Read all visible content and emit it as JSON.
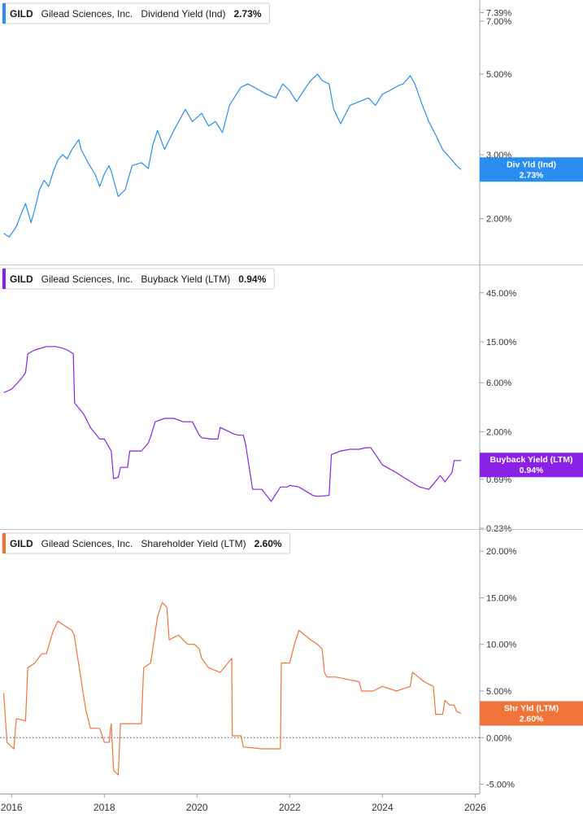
{
  "chart_data": [
    {
      "type": "line",
      "legend": {
        "ticker": "GILD",
        "company": "Gilead Sciences, Inc.",
        "metric": "Dividend Yield (Ind)",
        "value": "2.73%"
      },
      "color": "#2a8ef0",
      "scale": "log",
      "ylim": [
        1.7,
        7.6
      ],
      "yticks": [
        {
          "value": 7.39,
          "label": "7.39%"
        },
        {
          "value": 7.0,
          "label": "7.00%"
        },
        {
          "value": 5.0,
          "label": "5.00%"
        },
        {
          "value": 3.0,
          "label": "3.00%"
        },
        {
          "value": 2.0,
          "label": "2.00%"
        }
      ],
      "flag": {
        "label": "Div Yld (Ind)",
        "value": "2.73%",
        "at": 2.73
      },
      "x": [
        2015.83,
        2015.95,
        2016.1,
        2016.2,
        2016.3,
        2016.42,
        2016.5,
        2016.6,
        2016.7,
        2016.8,
        2016.9,
        2017.0,
        2017.1,
        2017.2,
        2017.3,
        2017.45,
        2017.5,
        2017.65,
        2017.8,
        2017.9,
        2018.0,
        2018.1,
        2018.15,
        2018.3,
        2018.45,
        2018.6,
        2018.8,
        2018.95,
        2019.05,
        2019.15,
        2019.3,
        2019.5,
        2019.75,
        2019.9,
        2020.1,
        2020.25,
        2020.4,
        2020.55,
        2020.7,
        2020.85,
        2020.95,
        2021.1,
        2021.3,
        2021.5,
        2021.7,
        2021.85,
        2022.0,
        2022.15,
        2022.3,
        2022.45,
        2022.6,
        2022.7,
        2022.85,
        2022.95,
        2023.1,
        2023.3,
        2023.5,
        2023.7,
        2023.85,
        2024.0,
        2024.15,
        2024.35,
        2024.45,
        2024.6,
        2024.7,
        2024.85,
        2025.0,
        2025.15,
        2025.3,
        2025.5,
        2025.6,
        2025.7
      ],
      "values": [
        1.82,
        1.78,
        1.9,
        2.05,
        2.2,
        1.95,
        2.12,
        2.4,
        2.55,
        2.45,
        2.7,
        2.9,
        3.0,
        2.92,
        3.1,
        3.3,
        3.1,
        2.85,
        2.65,
        2.45,
        2.65,
        2.8,
        2.7,
        2.3,
        2.4,
        2.8,
        2.85,
        2.75,
        3.2,
        3.5,
        3.1,
        3.5,
        4.0,
        3.7,
        3.9,
        3.6,
        3.7,
        3.45,
        4.1,
        4.4,
        4.6,
        4.7,
        4.55,
        4.4,
        4.3,
        4.7,
        4.5,
        4.2,
        4.5,
        4.8,
        5.0,
        4.8,
        4.7,
        4.0,
        3.65,
        4.1,
        4.2,
        4.3,
        4.1,
        4.4,
        4.5,
        4.65,
        4.7,
        4.95,
        4.7,
        4.15,
        3.7,
        3.4,
        3.1,
        2.9,
        2.8,
        2.73
      ]
    },
    {
      "type": "line",
      "legend": {
        "ticker": "GILD",
        "company": "Gilead Sciences, Inc.",
        "metric": "Buyback Yield (LTM)",
        "value": "0.94%"
      },
      "color": "#8a22e6",
      "scale": "log",
      "ylim": [
        0.23,
        60
      ],
      "yticks": [
        {
          "value": 45.0,
          "label": "45.00%"
        },
        {
          "value": 15.0,
          "label": "15.00%"
        },
        {
          "value": 6.0,
          "label": "6.00%"
        },
        {
          "value": 2.0,
          "label": "2.00%"
        },
        {
          "value": 0.69,
          "label": "0.69%"
        },
        {
          "value": 0.23,
          "label": "0.23%"
        }
      ],
      "flag": {
        "label": "Buyback Yield (LTM)",
        "value": "0.94%",
        "at": 0.95
      },
      "x": [
        2015.83,
        2016.0,
        2016.2,
        2016.3,
        2016.35,
        2016.5,
        2016.75,
        2016.95,
        2017.1,
        2017.2,
        2017.33,
        2017.36,
        2017.55,
        2017.7,
        2017.9,
        2018.0,
        2018.15,
        2018.2,
        2018.3,
        2018.35,
        2018.5,
        2018.55,
        2018.8,
        2018.95,
        2019.0,
        2019.1,
        2019.3,
        2019.5,
        2019.7,
        2019.9,
        2020.05,
        2020.1,
        2020.3,
        2020.45,
        2020.5,
        2020.8,
        2020.9,
        2021.0,
        2021.05,
        2021.2,
        2021.4,
        2021.6,
        2021.8,
        2021.95,
        2022.0,
        2022.2,
        2022.5,
        2022.6,
        2022.85,
        2022.9,
        2023.1,
        2023.3,
        2023.5,
        2023.65,
        2023.75,
        2023.8,
        2024.0,
        2024.3,
        2024.5,
        2024.8,
        2025.0,
        2025.1,
        2025.25,
        2025.35,
        2025.5,
        2025.55,
        2025.7
      ],
      "values": [
        4.8,
        5.2,
        6.5,
        7.5,
        11.5,
        12.5,
        13.5,
        13.5,
        13.0,
        12.5,
        11.5,
        3.8,
        3.0,
        2.2,
        1.7,
        1.7,
        1.3,
        0.7,
        0.72,
        0.9,
        0.9,
        1.3,
        1.3,
        1.55,
        1.8,
        2.5,
        2.7,
        2.7,
        2.5,
        2.5,
        1.85,
        1.75,
        1.7,
        1.7,
        2.2,
        1.9,
        1.85,
        1.85,
        1.5,
        0.55,
        0.55,
        0.42,
        0.58,
        0.58,
        0.6,
        0.58,
        0.48,
        0.47,
        0.48,
        1.2,
        1.3,
        1.35,
        1.35,
        1.4,
        1.4,
        1.3,
        0.95,
        0.8,
        0.7,
        0.58,
        0.55,
        0.62,
        0.75,
        0.65,
        0.8,
        1.05,
        1.05
      ]
    },
    {
      "type": "line",
      "legend": {
        "ticker": "GILD",
        "company": "Gilead Sciences, Inc.",
        "metric": "Shareholder Yield (LTM)",
        "value": "2.60%"
      },
      "color": "#f0733a",
      "scale": "linear",
      "ylim": [
        -6.0,
        21.5
      ],
      "zero_line": true,
      "yticks": [
        {
          "value": 20,
          "label": "20.00%"
        },
        {
          "value": 15,
          "label": "15.00%"
        },
        {
          "value": 10,
          "label": "10.00%"
        },
        {
          "value": 5,
          "label": "5.00%"
        },
        {
          "value": 0,
          "label": "0.00%"
        },
        {
          "value": -5,
          "label": "-5.00%"
        }
      ],
      "flag": {
        "label": "Shr Yld (LTM)",
        "value": "2.60%",
        "at": 2.6
      },
      "x": [
        2015.83,
        2015.9,
        2016.0,
        2016.05,
        2016.1,
        2016.15,
        2016.3,
        2016.35,
        2016.5,
        2016.65,
        2016.75,
        2016.9,
        2017.0,
        2017.3,
        2017.35,
        2017.6,
        2017.7,
        2017.9,
        2018.0,
        2018.1,
        2018.15,
        2018.2,
        2018.3,
        2018.35,
        2018.55,
        2018.8,
        2018.85,
        2019.0,
        2019.15,
        2019.25,
        2019.35,
        2019.4,
        2019.6,
        2019.8,
        2019.95,
        2020.05,
        2020.1,
        2020.25,
        2020.5,
        2020.75,
        2020.76,
        2020.95,
        2021.0,
        2021.4,
        2021.8,
        2021.82,
        2022.0,
        2022.1,
        2022.2,
        2022.45,
        2022.6,
        2022.7,
        2022.75,
        2022.8,
        2023.0,
        2023.3,
        2023.5,
        2023.55,
        2023.8,
        2024.0,
        2024.3,
        2024.6,
        2024.65,
        2024.9,
        2025.1,
        2025.15,
        2025.2,
        2025.3,
        2025.35,
        2025.45,
        2025.55,
        2025.6,
        2025.7
      ],
      "values": [
        4.8,
        -0.5,
        -1.0,
        -1.2,
        2.0,
        2.0,
        1.8,
        7.5,
        8.0,
        9.0,
        9.0,
        11.5,
        12.5,
        11.5,
        11.0,
        3.0,
        1.0,
        1.0,
        -0.5,
        -0.5,
        1.5,
        -3.5,
        -4.0,
        1.5,
        1.5,
        1.5,
        7.5,
        8.0,
        13.0,
        14.5,
        14.0,
        10.5,
        11.0,
        10.0,
        10.0,
        9.5,
        8.5,
        7.5,
        7.0,
        8.5,
        0.2,
        0.2,
        -1.0,
        -1.2,
        -1.2,
        8.0,
        8.0,
        10.0,
        11.5,
        10.5,
        10.0,
        9.5,
        7.0,
        6.5,
        6.5,
        6.2,
        6.0,
        5.0,
        5.0,
        5.5,
        5.0,
        5.5,
        7.0,
        6.0,
        5.5,
        2.5,
        2.5,
        2.5,
        4.0,
        3.5,
        3.5,
        2.8,
        2.6
      ]
    }
  ],
  "x_axis": {
    "range": [
      2015.75,
      2026.1
    ],
    "ticks": [
      {
        "value": 2016,
        "label": "2016"
      },
      {
        "value": 2018,
        "label": "2018"
      },
      {
        "value": 2020,
        "label": "2020"
      },
      {
        "value": 2022,
        "label": "2022"
      },
      {
        "value": 2024,
        "label": "2024"
      },
      {
        "value": 2026,
        "label": "2026"
      }
    ]
  }
}
